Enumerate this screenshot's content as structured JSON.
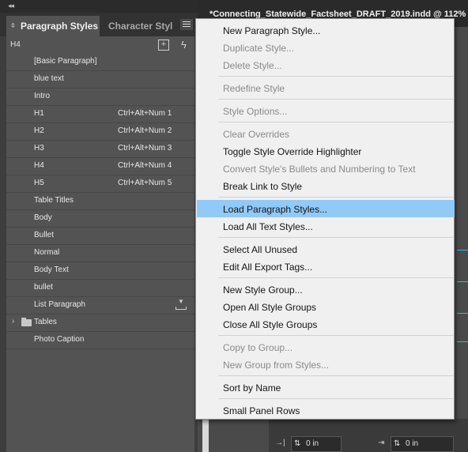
{
  "panel": {
    "collapse_glyph": "◂◂",
    "tabs": {
      "active": "Paragraph Styles",
      "inactive": "Character Styl"
    },
    "current_style": "H4",
    "styles": [
      {
        "name": "[Basic Paragraph]",
        "shortcut": ""
      },
      {
        "name": "blue text",
        "shortcut": ""
      },
      {
        "name": "Intro",
        "shortcut": ""
      },
      {
        "name": "H1",
        "shortcut": "Ctrl+Alt+Num 1"
      },
      {
        "name": "H2",
        "shortcut": "Ctrl+Alt+Num 2"
      },
      {
        "name": "H3",
        "shortcut": "Ctrl+Alt+Num 3"
      },
      {
        "name": "H4",
        "shortcut": "Ctrl+Alt+Num 4"
      },
      {
        "name": "H5",
        "shortcut": "Ctrl+Alt+Num 5"
      },
      {
        "name": "Table Titles",
        "shortcut": ""
      },
      {
        "name": "Body",
        "shortcut": ""
      },
      {
        "name": "Bullet",
        "shortcut": ""
      },
      {
        "name": "Normal",
        "shortcut": ""
      },
      {
        "name": "Body Text",
        "shortcut": ""
      },
      {
        "name": "bullet",
        "shortcut": ""
      },
      {
        "name": "List Paragraph",
        "shortcut": "",
        "icon": "import-icon"
      },
      {
        "name": "Tables",
        "shortcut": "",
        "icon": "folder-icon"
      },
      {
        "name": "Photo Caption",
        "shortcut": ""
      }
    ]
  },
  "document": {
    "title": "*Connecting_Statewide_Factsheet_DRAFT_2019.indd @ 112%",
    "fields": [
      "0 in",
      "0 in"
    ]
  },
  "menu": {
    "highlight_color": "#91c9f7",
    "groups": [
      [
        {
          "label": "New Paragraph Style...",
          "enabled": true
        },
        {
          "label": "Duplicate Style...",
          "enabled": false
        },
        {
          "label": "Delete Style...",
          "enabled": false
        }
      ],
      [
        {
          "label": "Redefine Style",
          "enabled": false
        }
      ],
      [
        {
          "label": "Style Options...",
          "enabled": false
        }
      ],
      [
        {
          "label": "Clear Overrides",
          "enabled": false
        },
        {
          "label": "Toggle Style Override Highlighter",
          "enabled": true
        },
        {
          "label": "Convert Style's Bullets and Numbering to Text",
          "enabled": false
        },
        {
          "label": "Break Link to Style",
          "enabled": true
        }
      ],
      [
        {
          "label": "Load Paragraph Styles...",
          "enabled": true,
          "highlighted": true
        },
        {
          "label": "Load All Text Styles...",
          "enabled": true
        }
      ],
      [
        {
          "label": "Select All Unused",
          "enabled": true
        },
        {
          "label": "Edit All Export Tags...",
          "enabled": true
        }
      ],
      [
        {
          "label": "New Style Group...",
          "enabled": true
        },
        {
          "label": "Open All Style Groups",
          "enabled": true
        },
        {
          "label": "Close All Style Groups",
          "enabled": true
        }
      ],
      [
        {
          "label": "Copy to Group...",
          "enabled": false
        },
        {
          "label": "New Group from Styles...",
          "enabled": false
        }
      ],
      [
        {
          "label": "Sort by Name",
          "enabled": true
        }
      ],
      [
        {
          "label": "Small Panel Rows",
          "enabled": true
        }
      ]
    ]
  }
}
